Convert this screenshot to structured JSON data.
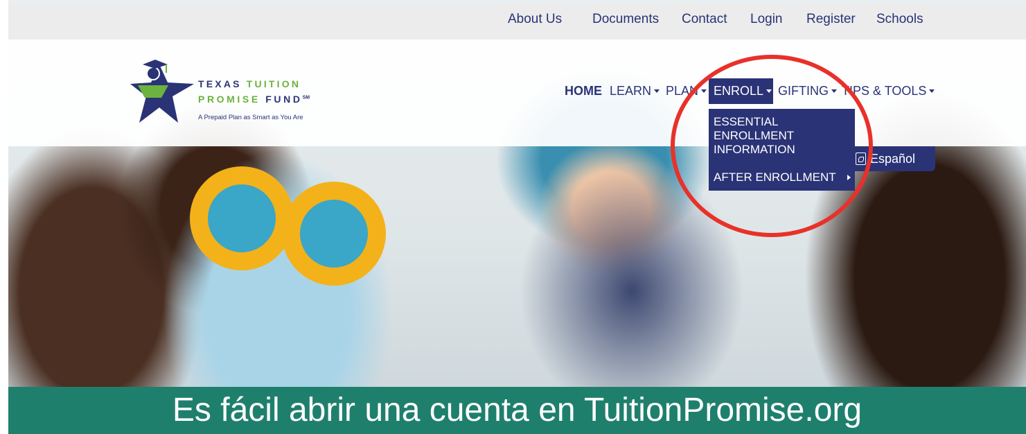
{
  "utility_nav": {
    "items": [
      "About Us",
      "Documents",
      "Contact",
      "Login",
      "Register",
      "Schools"
    ]
  },
  "logo": {
    "line1_a": "TEXAS ",
    "line1_b": "TUITION",
    "line2_a": "PROMISE ",
    "line2_b": "FUND",
    "line2_mark": "SM",
    "tagline": "A Prepaid Plan as Smart as You Are"
  },
  "main_nav": {
    "home": "HOME",
    "learn": "LEARN",
    "plan": "PLAN",
    "enroll": "ENROLL",
    "gifting": "GIFTING",
    "tips": "TIPS & TOOLS"
  },
  "dropdown": {
    "item1": "ESSENTIAL ENROLLMENT INFORMATION",
    "item2": "AFTER ENROLLMENT"
  },
  "espanol": {
    "label": "Español"
  },
  "banner": {
    "text": "Es fácil abrir una cuenta en TuitionPromise.org"
  },
  "colors": {
    "navy": "#2a3376",
    "green": "#6cb23e",
    "teal_banner": "#1f7f6d",
    "annotation_red": "#e8312a"
  }
}
